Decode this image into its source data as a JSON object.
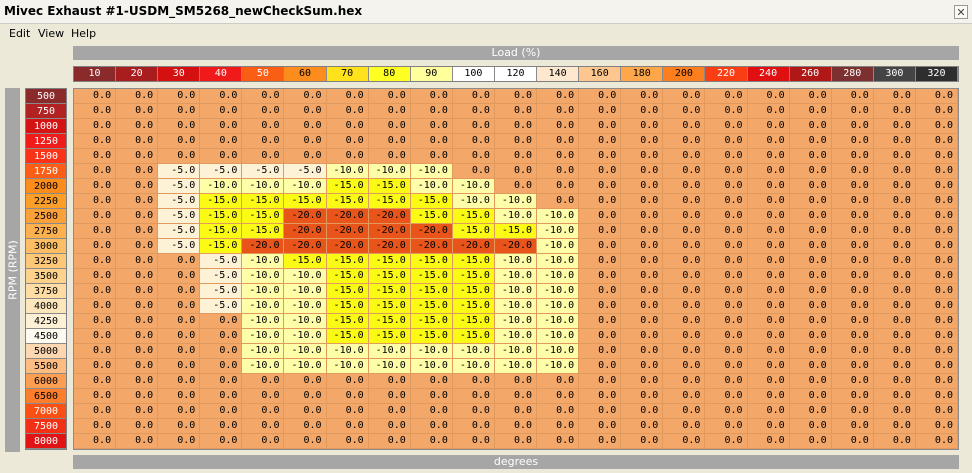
{
  "window": {
    "title": "Mivec Exhaust #1-USDM_SM5268_newCheckSum.hex",
    "close_icon": "close-icon"
  },
  "menu": [
    "Edit",
    "View",
    "Help"
  ],
  "table": {
    "x_label": "Load (%)",
    "y_label": "RPM (RPM)",
    "unit_label": "degrees",
    "x_values": [
      "10",
      "20",
      "30",
      "40",
      "50",
      "60",
      "70",
      "80",
      "90",
      "100",
      "120",
      "140",
      "160",
      "180",
      "200",
      "220",
      "240",
      "260",
      "280",
      "300",
      "320"
    ],
    "y_values": [
      "500",
      "750",
      "1000",
      "1250",
      "1500",
      "1750",
      "2000",
      "2250",
      "2500",
      "2750",
      "3000",
      "3250",
      "3500",
      "3750",
      "4000",
      "4250",
      "4500",
      "5000",
      "5500",
      "6000",
      "6500",
      "7000",
      "7500",
      "8000"
    ],
    "x_colors": [
      "#8b2a2a",
      "#a81e1e",
      "#d41010",
      "#f01a1a",
      "#fa5e14",
      "#fc8c1c",
      "#ffe21c",
      "#ffff24",
      "#ffff9c",
      "#ffffff",
      "#ffffff",
      "#fde7cf",
      "#fcc68e",
      "#fda64a",
      "#fc7e1c",
      "#fa3e14",
      "#e01010",
      "#b01818",
      "#7c3030",
      "#444444",
      "#2e2e2e"
    ],
    "y_colors": [
      "#8b2a2a",
      "#b22222",
      "#d41414",
      "#f01c1c",
      "#fa3218",
      "#fc5e18",
      "#fc8c1c",
      "#fd9e28",
      "#fca03a",
      "#fcb04e",
      "#fcbe64",
      "#fcc878",
      "#fdd28c",
      "#fedca4",
      "#fee6bc",
      "#fef0d6",
      "#fffaf0",
      "#fdd7b0",
      "#fcbc82",
      "#fc9e52",
      "#fc7e2c",
      "#fa5014",
      "#f23016",
      "#e01414"
    ],
    "colors": {
      "zero": "#f3a86a",
      "-5.0": "#fdf1d6",
      "-10.0": "#fefda8",
      "-15.0": "#fafa14",
      "-20.0": "#e9541a"
    },
    "rows": [
      [
        "0.0",
        "0.0",
        "0.0",
        "0.0",
        "0.0",
        "0.0",
        "0.0",
        "0.0",
        "0.0",
        "0.0",
        "0.0",
        "0.0",
        "0.0",
        "0.0",
        "0.0",
        "0.0",
        "0.0",
        "0.0",
        "0.0",
        "0.0",
        "0.0"
      ],
      [
        "0.0",
        "0.0",
        "0.0",
        "0.0",
        "0.0",
        "0.0",
        "0.0",
        "0.0",
        "0.0",
        "0.0",
        "0.0",
        "0.0",
        "0.0",
        "0.0",
        "0.0",
        "0.0",
        "0.0",
        "0.0",
        "0.0",
        "0.0",
        "0.0"
      ],
      [
        "0.0",
        "0.0",
        "0.0",
        "0.0",
        "0.0",
        "0.0",
        "0.0",
        "0.0",
        "0.0",
        "0.0",
        "0.0",
        "0.0",
        "0.0",
        "0.0",
        "0.0",
        "0.0",
        "0.0",
        "0.0",
        "0.0",
        "0.0",
        "0.0"
      ],
      [
        "0.0",
        "0.0",
        "0.0",
        "0.0",
        "0.0",
        "0.0",
        "0.0",
        "0.0",
        "0.0",
        "0.0",
        "0.0",
        "0.0",
        "0.0",
        "0.0",
        "0.0",
        "0.0",
        "0.0",
        "0.0",
        "0.0",
        "0.0",
        "0.0"
      ],
      [
        "0.0",
        "0.0",
        "0.0",
        "0.0",
        "0.0",
        "0.0",
        "0.0",
        "0.0",
        "0.0",
        "0.0",
        "0.0",
        "0.0",
        "0.0",
        "0.0",
        "0.0",
        "0.0",
        "0.0",
        "0.0",
        "0.0",
        "0.0",
        "0.0"
      ],
      [
        "0.0",
        "0.0",
        "-5.0",
        "-5.0",
        "-5.0",
        "-5.0",
        "-10.0",
        "-10.0",
        "-10.0",
        "0.0",
        "0.0",
        "0.0",
        "0.0",
        "0.0",
        "0.0",
        "0.0",
        "0.0",
        "0.0",
        "0.0",
        "0.0",
        "0.0"
      ],
      [
        "0.0",
        "0.0",
        "-5.0",
        "-10.0",
        "-10.0",
        "-10.0",
        "-15.0",
        "-15.0",
        "-10.0",
        "-10.0",
        "0.0",
        "0.0",
        "0.0",
        "0.0",
        "0.0",
        "0.0",
        "0.0",
        "0.0",
        "0.0",
        "0.0",
        "0.0"
      ],
      [
        "0.0",
        "0.0",
        "-5.0",
        "-15.0",
        "-15.0",
        "-15.0",
        "-15.0",
        "-15.0",
        "-15.0",
        "-10.0",
        "-10.0",
        "0.0",
        "0.0",
        "0.0",
        "0.0",
        "0.0",
        "0.0",
        "0.0",
        "0.0",
        "0.0",
        "0.0"
      ],
      [
        "0.0",
        "0.0",
        "-5.0",
        "-15.0",
        "-15.0",
        "-20.0",
        "-20.0",
        "-20.0",
        "-15.0",
        "-15.0",
        "-10.0",
        "-10.0",
        "0.0",
        "0.0",
        "0.0",
        "0.0",
        "0.0",
        "0.0",
        "0.0",
        "0.0",
        "0.0"
      ],
      [
        "0.0",
        "0.0",
        "-5.0",
        "-15.0",
        "-15.0",
        "-20.0",
        "-20.0",
        "-20.0",
        "-20.0",
        "-15.0",
        "-15.0",
        "-10.0",
        "0.0",
        "0.0",
        "0.0",
        "0.0",
        "0.0",
        "0.0",
        "0.0",
        "0.0",
        "0.0"
      ],
      [
        "0.0",
        "0.0",
        "-5.0",
        "-15.0",
        "-20.0",
        "-20.0",
        "-20.0",
        "-20.0",
        "-20.0",
        "-20.0",
        "-20.0",
        "-10.0",
        "0.0",
        "0.0",
        "0.0",
        "0.0",
        "0.0",
        "0.0",
        "0.0",
        "0.0",
        "0.0"
      ],
      [
        "0.0",
        "0.0",
        "0.0",
        "-5.0",
        "-10.0",
        "-15.0",
        "-15.0",
        "-15.0",
        "-15.0",
        "-15.0",
        "-10.0",
        "-10.0",
        "0.0",
        "0.0",
        "0.0",
        "0.0",
        "0.0",
        "0.0",
        "0.0",
        "0.0",
        "0.0"
      ],
      [
        "0.0",
        "0.0",
        "0.0",
        "-5.0",
        "-10.0",
        "-10.0",
        "-15.0",
        "-15.0",
        "-15.0",
        "-15.0",
        "-10.0",
        "-10.0",
        "0.0",
        "0.0",
        "0.0",
        "0.0",
        "0.0",
        "0.0",
        "0.0",
        "0.0",
        "0.0"
      ],
      [
        "0.0",
        "0.0",
        "0.0",
        "-5.0",
        "-10.0",
        "-10.0",
        "-15.0",
        "-15.0",
        "-15.0",
        "-15.0",
        "-10.0",
        "-10.0",
        "0.0",
        "0.0",
        "0.0",
        "0.0",
        "0.0",
        "0.0",
        "0.0",
        "0.0",
        "0.0"
      ],
      [
        "0.0",
        "0.0",
        "0.0",
        "-5.0",
        "-10.0",
        "-10.0",
        "-15.0",
        "-15.0",
        "-15.0",
        "-15.0",
        "-10.0",
        "-10.0",
        "0.0",
        "0.0",
        "0.0",
        "0.0",
        "0.0",
        "0.0",
        "0.0",
        "0.0",
        "0.0"
      ],
      [
        "0.0",
        "0.0",
        "0.0",
        "0.0",
        "-10.0",
        "-10.0",
        "-15.0",
        "-15.0",
        "-15.0",
        "-15.0",
        "-10.0",
        "-10.0",
        "0.0",
        "0.0",
        "0.0",
        "0.0",
        "0.0",
        "0.0",
        "0.0",
        "0.0",
        "0.0"
      ],
      [
        "0.0",
        "0.0",
        "0.0",
        "0.0",
        "-10.0",
        "-10.0",
        "-15.0",
        "-15.0",
        "-15.0",
        "-15.0",
        "-10.0",
        "-10.0",
        "0.0",
        "0.0",
        "0.0",
        "0.0",
        "0.0",
        "0.0",
        "0.0",
        "0.0",
        "0.0"
      ],
      [
        "0.0",
        "0.0",
        "0.0",
        "0.0",
        "-10.0",
        "-10.0",
        "-10.0",
        "-10.0",
        "-10.0",
        "-10.0",
        "-10.0",
        "-10.0",
        "0.0",
        "0.0",
        "0.0",
        "0.0",
        "0.0",
        "0.0",
        "0.0",
        "0.0",
        "0.0"
      ],
      [
        "0.0",
        "0.0",
        "0.0",
        "0.0",
        "-10.0",
        "-10.0",
        "-10.0",
        "-10.0",
        "-10.0",
        "-10.0",
        "-10.0",
        "-10.0",
        "0.0",
        "0.0",
        "0.0",
        "0.0",
        "0.0",
        "0.0",
        "0.0",
        "0.0",
        "0.0"
      ],
      [
        "0.0",
        "0.0",
        "0.0",
        "0.0",
        "0.0",
        "0.0",
        "0.0",
        "0.0",
        "0.0",
        "0.0",
        "0.0",
        "0.0",
        "0.0",
        "0.0",
        "0.0",
        "0.0",
        "0.0",
        "0.0",
        "0.0",
        "0.0",
        "0.0"
      ],
      [
        "0.0",
        "0.0",
        "0.0",
        "0.0",
        "0.0",
        "0.0",
        "0.0",
        "0.0",
        "0.0",
        "0.0",
        "0.0",
        "0.0",
        "0.0",
        "0.0",
        "0.0",
        "0.0",
        "0.0",
        "0.0",
        "0.0",
        "0.0",
        "0.0"
      ],
      [
        "0.0",
        "0.0",
        "0.0",
        "0.0",
        "0.0",
        "0.0",
        "0.0",
        "0.0",
        "0.0",
        "0.0",
        "0.0",
        "0.0",
        "0.0",
        "0.0",
        "0.0",
        "0.0",
        "0.0",
        "0.0",
        "0.0",
        "0.0",
        "0.0"
      ],
      [
        "0.0",
        "0.0",
        "0.0",
        "0.0",
        "0.0",
        "0.0",
        "0.0",
        "0.0",
        "0.0",
        "0.0",
        "0.0",
        "0.0",
        "0.0",
        "0.0",
        "0.0",
        "0.0",
        "0.0",
        "0.0",
        "0.0",
        "0.0",
        "0.0"
      ],
      [
        "0.0",
        "0.0",
        "0.0",
        "0.0",
        "0.0",
        "0.0",
        "0.0",
        "0.0",
        "0.0",
        "0.0",
        "0.0",
        "0.0",
        "0.0",
        "0.0",
        "0.0",
        "0.0",
        "0.0",
        "0.0",
        "0.0",
        "0.0",
        "0.0"
      ]
    ]
  }
}
